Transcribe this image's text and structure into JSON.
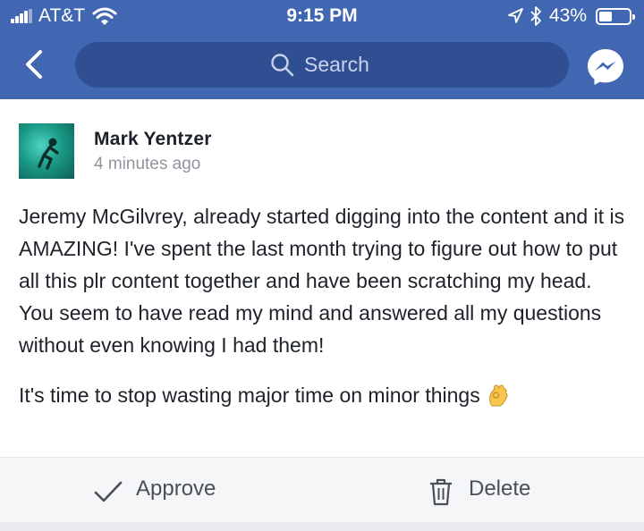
{
  "status_bar": {
    "carrier": "AT&T",
    "time": "9:15 PM",
    "battery_percent": "43%",
    "battery_level": 0.43,
    "icons": [
      "signal-icon",
      "wifi-icon",
      "location-icon",
      "bluetooth-icon",
      "battery-icon"
    ]
  },
  "nav": {
    "back_icon": "chevron-left-icon",
    "search_placeholder": "Search",
    "search_icon": "search-icon",
    "messenger_icon": "messenger-icon"
  },
  "post": {
    "author": "Mark Yentzer",
    "time_ago": "4 minutes ago",
    "paragraphs": [
      "Jeremy McGilvrey, already started digging into the content and it is AMAZING! I've spent the last month trying to figure out how to put all this plr content together and have been scratching my head. You seem to have read my mind and answered all my questions without even knowing I had them!",
      "It's time to stop wasting major time on minor things"
    ],
    "emoji": "ok-hand-emoji"
  },
  "actions": {
    "approve_label": "Approve",
    "delete_label": "Delete"
  },
  "colors": {
    "header": "#4267b2",
    "search_bg": "#2f4f92",
    "text": "#1d2129",
    "muted": "#90949c",
    "action_bar": "#f5f6f7"
  }
}
